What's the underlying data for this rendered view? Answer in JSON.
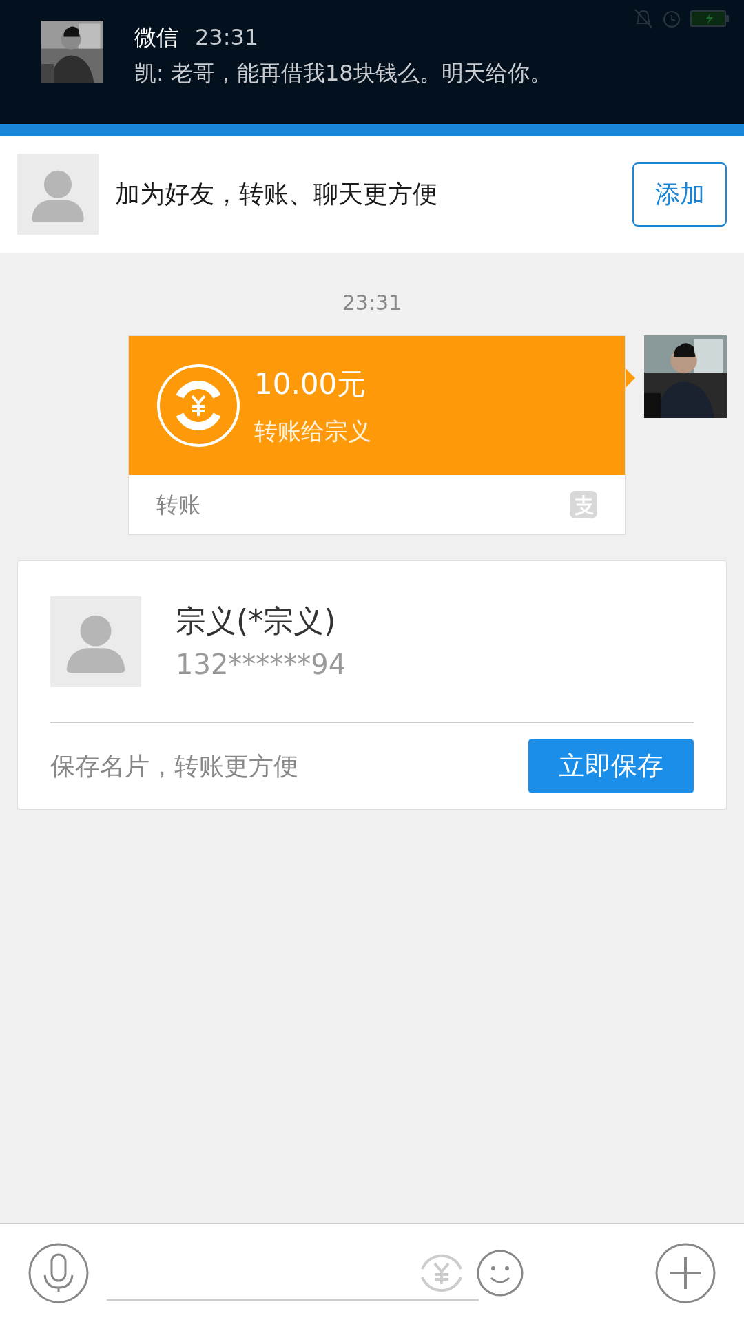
{
  "notification": {
    "app": "微信",
    "time": "23:31",
    "message": "凯: 老哥，能再借我18块钱么。明天给你。"
  },
  "friend_banner": {
    "text": "加为好友，转账、聊天更方便",
    "button": "添加"
  },
  "chat": {
    "timestamp": "23:31",
    "transfer": {
      "amount": "10.00元",
      "description": "转账给宗义",
      "footer": "转账"
    }
  },
  "contact_card": {
    "name": "宗义(*宗义)",
    "phone": "132******94",
    "hint": "保存名片，转账更方便",
    "button": "立即保存"
  }
}
